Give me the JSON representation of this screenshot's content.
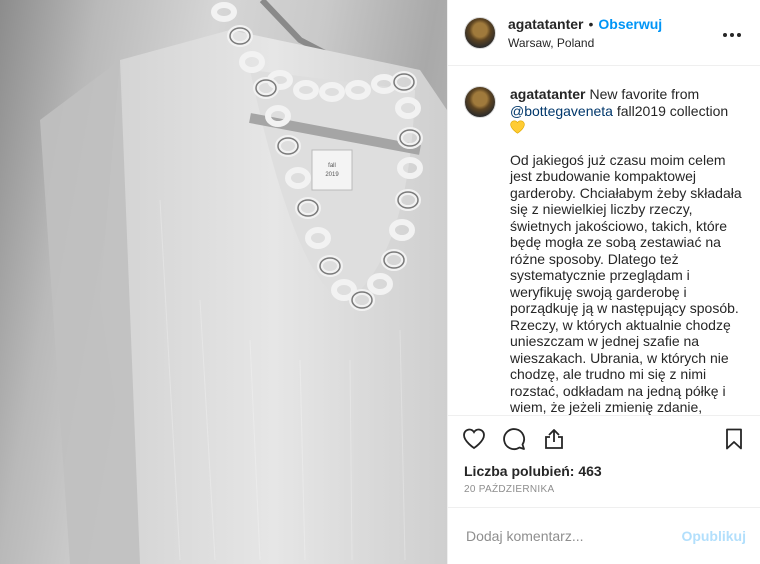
{
  "post": {
    "author": {
      "username": "agatatanter",
      "separator": "•",
      "follow_label": "Obserwuj",
      "location": "Warsaw, Poland"
    },
    "more_icon": "more-horizontal-icon",
    "caption": {
      "username": "agatatanter",
      "text_before_mention": "New favorite from",
      "mention": "@bottegaveneta",
      "text_after_mention": "fall2019 collection",
      "emoji": "yellow-heart",
      "paragraph": "Od jakiegoś już czasu moim celem jest zbudowanie kompaktowej garderoby. Chciałabym żeby składała się z niewielkiej liczby rzeczy, świetnych jakościowo, takich, które będę mogła ze sobą zestawiać na różne sposoby. Dlatego też systematycznie przeglądam i weryfikuję swoją garderobę i porządkuję ją w następujący sposób. Rzeczy, w których aktualnie chodzę unieszczam w jednej szafie na wieszakach. Ubrania, w których nie chodzę, ale trudno mi się z nimi rozstać, odkładam na jedną półkę i wiem, że jeżeli zmienię zdanie, znajdę"
    },
    "actions": {
      "like_icon": "heart-outline-icon",
      "comment_icon": "comment-icon",
      "share_icon": "share-icon",
      "save_icon": "bookmark-icon"
    },
    "likes": "Liczba polubień: 463",
    "date": "20 PAŹDZIERNIKA",
    "add_comment": {
      "placeholder": "Dodaj komentarz...",
      "post_label": "Opublikuj"
    },
    "colors": {
      "accent": "#0095f6",
      "mention": "#00376b",
      "post_disabled": "#b2dffc",
      "muted": "#8e8e8e",
      "emoji": "#ffcc33"
    },
    "photo": {
      "tag_line1": "fall",
      "tag_line2": "2019"
    }
  }
}
